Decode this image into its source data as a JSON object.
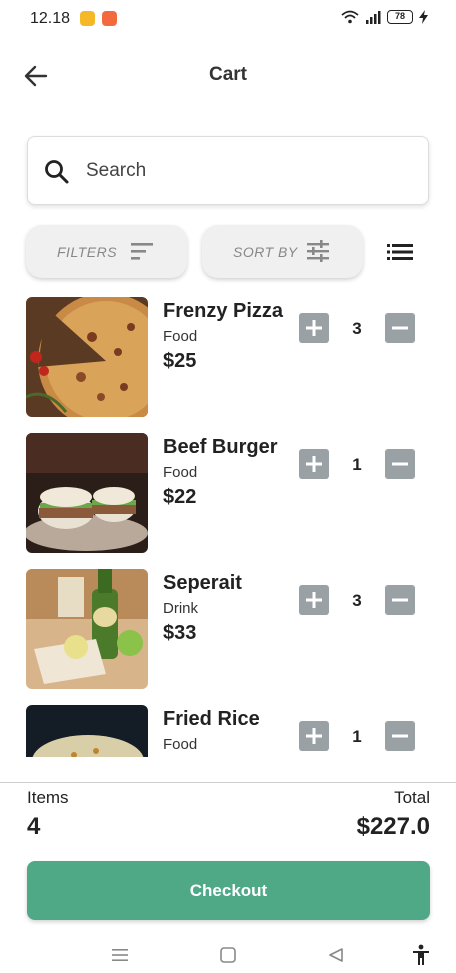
{
  "status_bar": {
    "time": "12.18",
    "battery": "78"
  },
  "app_bar": {
    "title": "Cart"
  },
  "search": {
    "placeholder": "Search"
  },
  "filters": {
    "filters_label": "FILTERS",
    "sort_label": "SORT BY"
  },
  "items": [
    {
      "name": "Frenzy Pizza",
      "category": "Food",
      "price": "$25",
      "quantity": "3"
    },
    {
      "name": "Beef Burger",
      "category": "Food",
      "price": "$22",
      "quantity": "1"
    },
    {
      "name": "Seperait",
      "category": "Drink",
      "price": "$33",
      "quantity": "3"
    },
    {
      "name": "Fried Rice",
      "category": "Food",
      "price": "",
      "quantity": "1"
    }
  ],
  "summary": {
    "items_label": "Items",
    "items_count": "4",
    "total_label": "Total",
    "total_value": "$227.0"
  },
  "checkout": {
    "label": "Checkout"
  },
  "colors": {
    "accent": "#4fa886",
    "qty_button": "#9aa1a5"
  },
  "icons": [
    "back-arrow-icon",
    "search-icon",
    "filter-lines-icon",
    "sliders-icon",
    "list-view-icon",
    "plus-icon",
    "minus-icon",
    "wifi-icon",
    "signal-icon",
    "battery-icon",
    "charging-icon",
    "menu-icon",
    "home-square-icon",
    "back-triangle-icon",
    "accessibility-icon"
  ]
}
